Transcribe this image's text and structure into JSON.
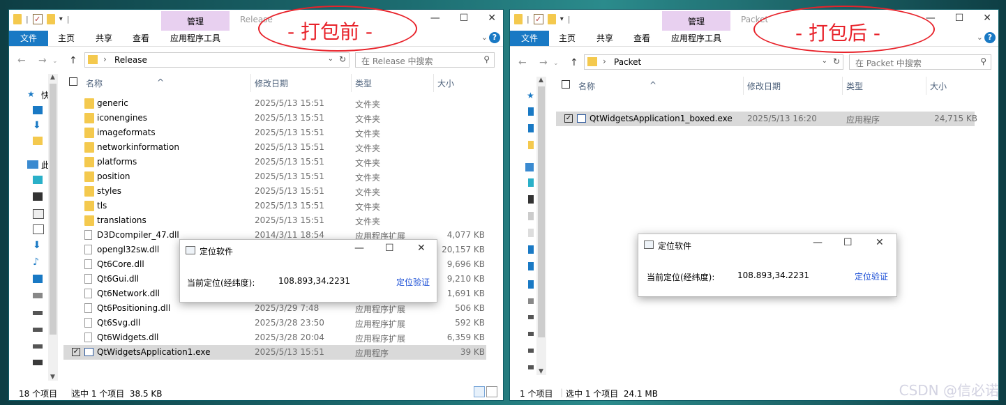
{
  "left": {
    "title": "Release",
    "manage_tab": "管理",
    "tabs": [
      "文件",
      "主页",
      "共享",
      "查看",
      "应用程序工具"
    ],
    "address": "Release",
    "search_placeholder": "在 Release 中搜索",
    "columns": [
      "名称",
      "修改日期",
      "类型",
      "大小"
    ],
    "rows": [
      {
        "name": "generic",
        "date": "2025/5/13 15:51",
        "type": "文件夹",
        "size": ""
      },
      {
        "name": "iconengines",
        "date": "2025/5/13 15:51",
        "type": "文件夹",
        "size": ""
      },
      {
        "name": "imageformats",
        "date": "2025/5/13 15:51",
        "type": "文件夹",
        "size": ""
      },
      {
        "name": "networkinformation",
        "date": "2025/5/13 15:51",
        "type": "文件夹",
        "size": ""
      },
      {
        "name": "platforms",
        "date": "2025/5/13 15:51",
        "type": "文件夹",
        "size": ""
      },
      {
        "name": "position",
        "date": "2025/5/13 15:51",
        "type": "文件夹",
        "size": ""
      },
      {
        "name": "styles",
        "date": "2025/5/13 15:51",
        "type": "文件夹",
        "size": ""
      },
      {
        "name": "tls",
        "date": "2025/5/13 15:51",
        "type": "文件夹",
        "size": ""
      },
      {
        "name": "translations",
        "date": "2025/5/13 15:51",
        "type": "文件夹",
        "size": ""
      },
      {
        "name": "D3Dcompiler_47.dll",
        "date": "2014/3/11 18:54",
        "type": "应用程序扩展",
        "size": "4,077 KB"
      },
      {
        "name": "opengl32sw.dll",
        "date": "",
        "type": "",
        "size": "20,157 KB"
      },
      {
        "name": "Qt6Core.dll",
        "date": "",
        "type": "",
        "size": "9,696 KB"
      },
      {
        "name": "Qt6Gui.dll",
        "date": "",
        "type": "",
        "size": "9,210 KB"
      },
      {
        "name": "Qt6Network.dll",
        "date": "",
        "type": "",
        "size": "1,691 KB"
      },
      {
        "name": "Qt6Positioning.dll",
        "date": "2025/3/29 7:48",
        "type": "应用程序扩展",
        "size": "506 KB"
      },
      {
        "name": "Qt6Svg.dll",
        "date": "2025/3/28 23:50",
        "type": "应用程序扩展",
        "size": "592 KB"
      },
      {
        "name": "Qt6Widgets.dll",
        "date": "2025/3/28 20:04",
        "type": "应用程序扩展",
        "size": "6,359 KB"
      },
      {
        "name": "QtWidgetsApplication1.exe",
        "date": "2025/5/13 15:51",
        "type": "应用程序",
        "size": "39 KB"
      }
    ],
    "status_count": "18 个项目",
    "status_selected": "选中 1 个项目  38.5 KB",
    "annotation": "- 打包前 -",
    "dialog": {
      "title": "定位软件",
      "label": "当前定位(经纬度):",
      "value": "108.893,34.2231",
      "link": "定位验证"
    }
  },
  "right": {
    "title": "Packet",
    "manage_tab": "管理",
    "tabs": [
      "文件",
      "主页",
      "共享",
      "查看",
      "应用程序工具"
    ],
    "address": "Packet",
    "search_placeholder": "在 Packet 中搜索",
    "columns": [
      "名称",
      "修改日期",
      "类型",
      "大小"
    ],
    "rows": [
      {
        "name": "QtWidgetsApplication1_boxed.exe",
        "date": "2025/5/13 16:20",
        "type": "应用程序",
        "size": "24,715 KB"
      }
    ],
    "status_count": "1 个项目",
    "status_selected": "选中 1 个项目  24.1 MB",
    "annotation": "- 打包后 -",
    "dialog": {
      "title": "定位软件",
      "label": "当前定位(经纬度):",
      "value": "108.893,34.2231",
      "link": "定位验证"
    }
  },
  "watermark": "CSDN @信必诺",
  "colors": {
    "accent": "#1979c4",
    "manage": "#e8d0f0",
    "annotation": "#e8232b",
    "link": "#1b4fd6",
    "selected_row": "#d9d9d9"
  }
}
